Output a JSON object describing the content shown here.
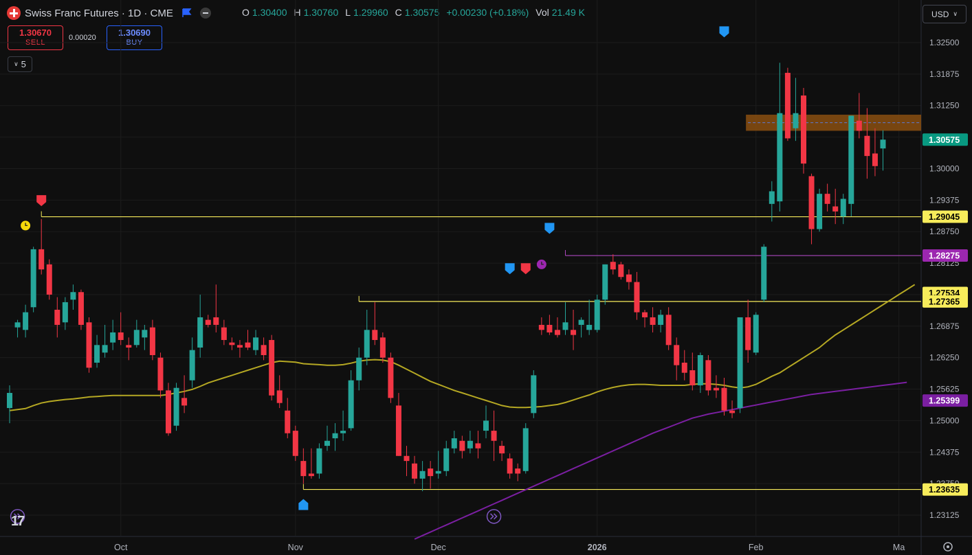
{
  "header": {
    "symbol_title": "Swiss Franc Futures · 1D · CME",
    "open_label": "O",
    "open": "1.30400",
    "high_label": "H",
    "high": "1.30760",
    "low_label": "L",
    "low": "1.29960",
    "close_label": "C",
    "close": "1.30575",
    "change": "+0.00230 (+0.18%)",
    "vol_label": "Vol",
    "vol": "21.49 K"
  },
  "trade": {
    "sell_price": "1.30670",
    "sell_label": "SELL",
    "spread": "0.00020",
    "buy_price": "1.30690",
    "buy_label": "BUY"
  },
  "interval": {
    "value": "5"
  },
  "currency": {
    "value": "USD"
  },
  "colors": {
    "up": "#26a69a",
    "down": "#f23645",
    "ma_short": "#b5a823",
    "ma_long": "#7b1fa2",
    "hline": "#f7ec5b",
    "zone": "#8a4f10"
  },
  "chart_data": {
    "type": "candlestick",
    "y_ticks": [
      "1.32500",
      "1.31875",
      "1.31250",
      "1.30625",
      "1.30000",
      "1.29375",
      "1.28750",
      "1.28125",
      "1.27500",
      "1.26875",
      "1.26250",
      "1.25625",
      "1.25000",
      "1.24375",
      "1.23750",
      "1.23125"
    ],
    "x_ticks": [
      {
        "label": "Oct",
        "bar": 14
      },
      {
        "label": "Nov",
        "bar": 36
      },
      {
        "label": "Dec",
        "bar": 54
      },
      {
        "label": "2026",
        "bar": 74
      },
      {
        "label": "Feb",
        "bar": 94
      },
      {
        "label": "Ma",
        "bar": 112
      }
    ],
    "ylim": [
      1.2285,
      1.3265
    ],
    "price_labels": [
      {
        "value": "1.30575",
        "price": 1.30575,
        "color": "#089981",
        "text_color": "#ffffff"
      },
      {
        "value": "1.29045",
        "price": 1.29045,
        "color": "#f7ec5b",
        "text_color": "#000000"
      },
      {
        "value": "1.28275",
        "price": 1.28275,
        "color": "#9c27b0",
        "text_color": "#ffffff"
      },
      {
        "value": "1.27534",
        "price": 1.27534,
        "color": "#f7ec5b",
        "text_color": "#000000"
      },
      {
        "value": "1.27365",
        "price": 1.27365,
        "color": "#f7ec5b",
        "text_color": "#000000"
      },
      {
        "value": "1.25399",
        "price": 1.25399,
        "color": "#7b1fa2",
        "text_color": "#ffffff"
      },
      {
        "value": "1.23635",
        "price": 1.23635,
        "color": "#f7ec5b",
        "text_color": "#000000"
      }
    ],
    "hlines": [
      {
        "price": 1.29045,
        "from_bar": 4,
        "color": "#f7ec5b"
      },
      {
        "price": 1.28275,
        "from_bar": 70,
        "color": "#ab47bc"
      },
      {
        "price": 1.27365,
        "from_bar": 44,
        "color": "#f7ec5b"
      },
      {
        "price": 1.23635,
        "from_bar": 37,
        "color": "#f7ec5b"
      }
    ],
    "zone": {
      "from_bar": 93,
      "top": 1.3107,
      "bottom": 1.3075
    },
    "candles": [
      {
        "o": 1.2525,
        "h": 1.257,
        "l": 1.2495,
        "c": 1.2555
      },
      {
        "o": 1.2685,
        "h": 1.27,
        "l": 1.2665,
        "c": 1.2695
      },
      {
        "o": 1.268,
        "h": 1.273,
        "l": 1.2665,
        "c": 1.2715
      },
      {
        "o": 1.2725,
        "h": 1.2845,
        "l": 1.2715,
        "c": 1.284
      },
      {
        "o": 1.284,
        "h": 1.29,
        "l": 1.279,
        "c": 1.28
      },
      {
        "o": 1.281,
        "h": 1.282,
        "l": 1.274,
        "c": 1.275
      },
      {
        "o": 1.272,
        "h": 1.2745,
        "l": 1.2665,
        "c": 1.269
      },
      {
        "o": 1.2695,
        "h": 1.2745,
        "l": 1.268,
        "c": 1.2735
      },
      {
        "o": 1.274,
        "h": 1.277,
        "l": 1.272,
        "c": 1.2755
      },
      {
        "o": 1.2755,
        "h": 1.276,
        "l": 1.268,
        "c": 1.269
      },
      {
        "o": 1.2695,
        "h": 1.2705,
        "l": 1.2595,
        "c": 1.2605
      },
      {
        "o": 1.2615,
        "h": 1.267,
        "l": 1.2605,
        "c": 1.265
      },
      {
        "o": 1.2635,
        "h": 1.269,
        "l": 1.2625,
        "c": 1.265
      },
      {
        "o": 1.2655,
        "h": 1.27,
        "l": 1.264,
        "c": 1.2675
      },
      {
        "o": 1.2675,
        "h": 1.2715,
        "l": 1.265,
        "c": 1.266
      },
      {
        "o": 1.265,
        "h": 1.2665,
        "l": 1.262,
        "c": 1.2645
      },
      {
        "o": 1.265,
        "h": 1.27,
        "l": 1.2645,
        "c": 1.268
      },
      {
        "o": 1.2665,
        "h": 1.269,
        "l": 1.264,
        "c": 1.268
      },
      {
        "o": 1.2685,
        "h": 1.27,
        "l": 1.262,
        "c": 1.263
      },
      {
        "o": 1.2625,
        "h": 1.2635,
        "l": 1.2545,
        "c": 1.256
      },
      {
        "o": 1.256,
        "h": 1.2575,
        "l": 1.247,
        "c": 1.2475
      },
      {
        "o": 1.249,
        "h": 1.2575,
        "l": 1.248,
        "c": 1.2565
      },
      {
        "o": 1.2545,
        "h": 1.259,
        "l": 1.2515,
        "c": 1.253
      },
      {
        "o": 1.258,
        "h": 1.2665,
        "l": 1.2565,
        "c": 1.264
      },
      {
        "o": 1.2645,
        "h": 1.275,
        "l": 1.2625,
        "c": 1.2705
      },
      {
        "o": 1.27,
        "h": 1.271,
        "l": 1.2685,
        "c": 1.269
      },
      {
        "o": 1.2705,
        "h": 1.277,
        "l": 1.2675,
        "c": 1.269
      },
      {
        "o": 1.2685,
        "h": 1.27,
        "l": 1.265,
        "c": 1.266
      },
      {
        "o": 1.2655,
        "h": 1.2665,
        "l": 1.264,
        "c": 1.265
      },
      {
        "o": 1.265,
        "h": 1.266,
        "l": 1.2625,
        "c": 1.2645
      },
      {
        "o": 1.2655,
        "h": 1.268,
        "l": 1.264,
        "c": 1.2645
      },
      {
        "o": 1.264,
        "h": 1.268,
        "l": 1.263,
        "c": 1.2665
      },
      {
        "o": 1.265,
        "h": 1.2665,
        "l": 1.262,
        "c": 1.263
      },
      {
        "o": 1.266,
        "h": 1.267,
        "l": 1.254,
        "c": 1.255
      },
      {
        "o": 1.256,
        "h": 1.259,
        "l": 1.2525,
        "c": 1.2535
      },
      {
        "o": 1.252,
        "h": 1.2545,
        "l": 1.2465,
        "c": 1.2475
      },
      {
        "o": 1.248,
        "h": 1.249,
        "l": 1.242,
        "c": 1.243
      },
      {
        "o": 1.242,
        "h": 1.2445,
        "l": 1.2375,
        "c": 1.239
      },
      {
        "o": 1.2395,
        "h": 1.2445,
        "l": 1.2385,
        "c": 1.239
      },
      {
        "o": 1.2395,
        "h": 1.2455,
        "l": 1.2385,
        "c": 1.2445
      },
      {
        "o": 1.245,
        "h": 1.249,
        "l": 1.244,
        "c": 1.246
      },
      {
        "o": 1.2465,
        "h": 1.2495,
        "l": 1.244,
        "c": 1.2475
      },
      {
        "o": 1.2475,
        "h": 1.252,
        "l": 1.246,
        "c": 1.248
      },
      {
        "o": 1.2485,
        "h": 1.26,
        "l": 1.248,
        "c": 1.258
      },
      {
        "o": 1.258,
        "h": 1.2645,
        "l": 1.256,
        "c": 1.2625
      },
      {
        "o": 1.2625,
        "h": 1.272,
        "l": 1.261,
        "c": 1.268
      },
      {
        "o": 1.268,
        "h": 1.2735,
        "l": 1.265,
        "c": 1.266
      },
      {
        "o": 1.2665,
        "h": 1.2675,
        "l": 1.2615,
        "c": 1.2625
      },
      {
        "o": 1.2625,
        "h": 1.2635,
        "l": 1.2535,
        "c": 1.2545
      },
      {
        "o": 1.253,
        "h": 1.2555,
        "l": 1.243,
        "c": 1.243
      },
      {
        "o": 1.243,
        "h": 1.245,
        "l": 1.239,
        "c": 1.242
      },
      {
        "o": 1.2415,
        "h": 1.243,
        "l": 1.2375,
        "c": 1.2385
      },
      {
        "o": 1.2385,
        "h": 1.242,
        "l": 1.236,
        "c": 1.24
      },
      {
        "o": 1.2405,
        "h": 1.242,
        "l": 1.2365,
        "c": 1.239
      },
      {
        "o": 1.2395,
        "h": 1.244,
        "l": 1.2385,
        "c": 1.24
      },
      {
        "o": 1.24,
        "h": 1.246,
        "l": 1.239,
        "c": 1.2445
      },
      {
        "o": 1.2445,
        "h": 1.248,
        "l": 1.2435,
        "c": 1.2465
      },
      {
        "o": 1.246,
        "h": 1.247,
        "l": 1.2425,
        "c": 1.244
      },
      {
        "o": 1.2445,
        "h": 1.248,
        "l": 1.2435,
        "c": 1.246
      },
      {
        "o": 1.2455,
        "h": 1.248,
        "l": 1.2425,
        "c": 1.2445
      },
      {
        "o": 1.248,
        "h": 1.253,
        "l": 1.2465,
        "c": 1.25
      },
      {
        "o": 1.248,
        "h": 1.252,
        "l": 1.242,
        "c": 1.246
      },
      {
        "o": 1.245,
        "h": 1.246,
        "l": 1.242,
        "c": 1.2435
      },
      {
        "o": 1.2425,
        "h": 1.2435,
        "l": 1.2385,
        "c": 1.2395
      },
      {
        "o": 1.2405,
        "h": 1.2415,
        "l": 1.238,
        "c": 1.2395
      },
      {
        "o": 1.24,
        "h": 1.2495,
        "l": 1.2395,
        "c": 1.2485
      },
      {
        "o": 1.2515,
        "h": 1.26,
        "l": 1.2505,
        "c": 1.259
      },
      {
        "o": 1.269,
        "h": 1.2705,
        "l": 1.267,
        "c": 1.268
      },
      {
        "o": 1.269,
        "h": 1.271,
        "l": 1.267,
        "c": 1.2675
      },
      {
        "o": 1.268,
        "h": 1.2705,
        "l": 1.2665,
        "c": 1.267
      },
      {
        "o": 1.268,
        "h": 1.2735,
        "l": 1.267,
        "c": 1.2695
      },
      {
        "o": 1.268,
        "h": 1.272,
        "l": 1.264,
        "c": 1.267
      },
      {
        "o": 1.269,
        "h": 1.2705,
        "l": 1.2665,
        "c": 1.27
      },
      {
        "o": 1.268,
        "h": 1.274,
        "l": 1.267,
        "c": 1.269
      },
      {
        "o": 1.268,
        "h": 1.275,
        "l": 1.2675,
        "c": 1.274
      },
      {
        "o": 1.274,
        "h": 1.281,
        "l": 1.273,
        "c": 1.281
      },
      {
        "o": 1.2815,
        "h": 1.283,
        "l": 1.279,
        "c": 1.28
      },
      {
        "o": 1.281,
        "h": 1.2815,
        "l": 1.278,
        "c": 1.2785
      },
      {
        "o": 1.279,
        "h": 1.28,
        "l": 1.276,
        "c": 1.2775
      },
      {
        "o": 1.2775,
        "h": 1.2795,
        "l": 1.27,
        "c": 1.2715
      },
      {
        "o": 1.2715,
        "h": 1.272,
        "l": 1.2685,
        "c": 1.2705
      },
      {
        "o": 1.2705,
        "h": 1.2725,
        "l": 1.2675,
        "c": 1.269
      },
      {
        "o": 1.269,
        "h": 1.272,
        "l": 1.2675,
        "c": 1.271
      },
      {
        "o": 1.271,
        "h": 1.2725,
        "l": 1.264,
        "c": 1.265
      },
      {
        "o": 1.265,
        "h": 1.2665,
        "l": 1.258,
        "c": 1.261
      },
      {
        "o": 1.2615,
        "h": 1.264,
        "l": 1.258,
        "c": 1.2595
      },
      {
        "o": 1.26,
        "h": 1.2635,
        "l": 1.256,
        "c": 1.257
      },
      {
        "o": 1.257,
        "h": 1.2635,
        "l": 1.2555,
        "c": 1.263
      },
      {
        "o": 1.262,
        "h": 1.263,
        "l": 1.255,
        "c": 1.256
      },
      {
        "o": 1.2565,
        "h": 1.259,
        "l": 1.2545,
        "c": 1.256
      },
      {
        "o": 1.2565,
        "h": 1.2585,
        "l": 1.251,
        "c": 1.252
      },
      {
        "o": 1.252,
        "h": 1.254,
        "l": 1.2505,
        "c": 1.2515
      },
      {
        "o": 1.2525,
        "h": 1.2705,
        "l": 1.2515,
        "c": 1.2705
      },
      {
        "o": 1.2705,
        "h": 1.274,
        "l": 1.2615,
        "c": 1.264
      },
      {
        "o": 1.2635,
        "h": 1.2715,
        "l": 1.263,
        "c": 1.271
      },
      {
        "o": 1.274,
        "h": 1.285,
        "l": 1.2735,
        "c": 1.2845
      },
      {
        "o": 1.293,
        "h": 1.2975,
        "l": 1.2895,
        "c": 1.2955
      },
      {
        "o": 1.2935,
        "h": 1.321,
        "l": 1.2915,
        "c": 1.311
      },
      {
        "o": 1.319,
        "h": 1.32,
        "l": 1.3055,
        "c": 1.306
      },
      {
        "o": 1.308,
        "h": 1.318,
        "l": 1.3055,
        "c": 1.311
      },
      {
        "o": 1.3145,
        "h": 1.316,
        "l": 1.299,
        "c": 1.301
      },
      {
        "o": 1.2985,
        "h": 1.299,
        "l": 1.285,
        "c": 1.288
      },
      {
        "o": 1.288,
        "h": 1.296,
        "l": 1.2875,
        "c": 1.295
      },
      {
        "o": 1.295,
        "h": 1.297,
        "l": 1.2915,
        "c": 1.293
      },
      {
        "o": 1.2925,
        "h": 1.296,
        "l": 1.289,
        "c": 1.2915
      },
      {
        "o": 1.2905,
        "h": 1.295,
        "l": 1.289,
        "c": 1.294
      },
      {
        "o": 1.293,
        "h": 1.3105,
        "l": 1.2905,
        "c": 1.3105
      },
      {
        "o": 1.3095,
        "h": 1.315,
        "l": 1.306,
        "c": 1.3075
      },
      {
        "o": 1.3065,
        "h": 1.312,
        "l": 1.298,
        "c": 1.3025
      },
      {
        "o": 1.303,
        "h": 1.308,
        "l": 1.2985,
        "c": 1.3005
      },
      {
        "o": 1.304,
        "h": 1.3076,
        "l": 1.2996,
        "c": 1.30575
      }
    ],
    "ma_short": [
      1.252,
      1.2522,
      1.2524,
      1.253,
      1.2535,
      1.2538,
      1.254,
      1.2542,
      1.2543,
      1.2545,
      1.2547,
      1.2548,
      1.2549,
      1.255,
      1.255,
      1.255,
      1.255,
      1.255,
      1.255,
      1.255,
      1.2552,
      1.2555,
      1.2558,
      1.2562,
      1.2568,
      1.2575,
      1.258,
      1.2585,
      1.259,
      1.2595,
      1.26,
      1.2605,
      1.261,
      1.2615,
      1.2618,
      1.2617,
      1.2616,
      1.2613,
      1.2612,
      1.2611,
      1.261,
      1.261,
      1.2611,
      1.2614,
      1.2618,
      1.262,
      1.2621,
      1.262,
      1.2617,
      1.261,
      1.2602,
      1.2594,
      1.2586,
      1.2578,
      1.2572,
      1.2566,
      1.256,
      1.2555,
      1.255,
      1.2545,
      1.254,
      1.2535,
      1.253,
      1.2527,
      1.2526,
      1.2526,
      1.2527,
      1.2528,
      1.253,
      1.2532,
      1.2536,
      1.2541,
      1.2546,
      1.2551,
      1.2557,
      1.2562,
      1.2566,
      1.2569,
      1.2571,
      1.2572,
      1.2572,
      1.2571,
      1.257,
      1.257,
      1.257,
      1.257,
      1.2572,
      1.2573,
      1.2573,
      1.2572,
      1.257,
      1.2567,
      1.2565,
      1.2567,
      1.2572,
      1.258,
      1.2588,
      1.2595,
      1.2605,
      1.2615,
      1.2625,
      1.2635,
      1.2645,
      1.2658,
      1.267,
      1.268,
      1.269,
      1.27,
      1.271,
      1.272,
      1.273,
      1.274,
      1.275,
      1.276,
      1.277
    ],
    "ma_long_start": 51,
    "ma_long": [
      1.2265,
      1.2272,
      1.2279,
      1.2286,
      1.2293,
      1.23,
      1.2307,
      1.2314,
      1.2321,
      1.2328,
      1.2335,
      1.2342,
      1.2349,
      1.2356,
      1.2363,
      1.237,
      1.2377,
      1.2384,
      1.2391,
      1.2398,
      1.2405,
      1.2412,
      1.2419,
      1.2426,
      1.2433,
      1.244,
      1.2447,
      1.2454,
      1.2461,
      1.2468,
      1.2475,
      1.2481,
      1.2487,
      1.2493,
      1.2499,
      1.2505,
      1.2509,
      1.2513,
      1.2516,
      1.2519,
      1.2522,
      1.2525,
      1.2528,
      1.2531,
      1.2534,
      1.2537,
      1.254,
      1.2543,
      1.2546,
      1.2549,
      1.2552,
      1.2554,
      1.2556,
      1.2558,
      1.256,
      1.2562,
      1.2564,
      1.2566,
      1.2568,
      1.257,
      1.2572,
      1.2574,
      1.2576
    ],
    "markers": [
      {
        "bar": 4,
        "price": 1.2935,
        "kind": "flag-down",
        "color": "#f23645"
      },
      {
        "bar": 2,
        "price": 1.2887,
        "kind": "alarm",
        "color": "#f5d90a"
      },
      {
        "bar": 37,
        "price": 1.2335,
        "kind": "flag-up",
        "color": "#2196f3"
      },
      {
        "bar": 63,
        "price": 1.28,
        "kind": "flag-down",
        "color": "#2196f3"
      },
      {
        "bar": 65,
        "price": 1.28,
        "kind": "flag-down",
        "color": "#f23645"
      },
      {
        "bar": 68,
        "price": 1.288,
        "kind": "flag-down",
        "color": "#2196f3"
      },
      {
        "bar": 67,
        "price": 1.281,
        "kind": "alarm",
        "color": "#9c27b0"
      },
      {
        "bar": 90,
        "price": 1.327,
        "kind": "flag-down",
        "color": "#2196f3"
      },
      {
        "bar": 1,
        "price": 1.231,
        "kind": "replay",
        "color": "#7e57c2"
      },
      {
        "bar": 61,
        "price": 1.231,
        "kind": "replay",
        "color": "#7e57c2"
      }
    ]
  }
}
